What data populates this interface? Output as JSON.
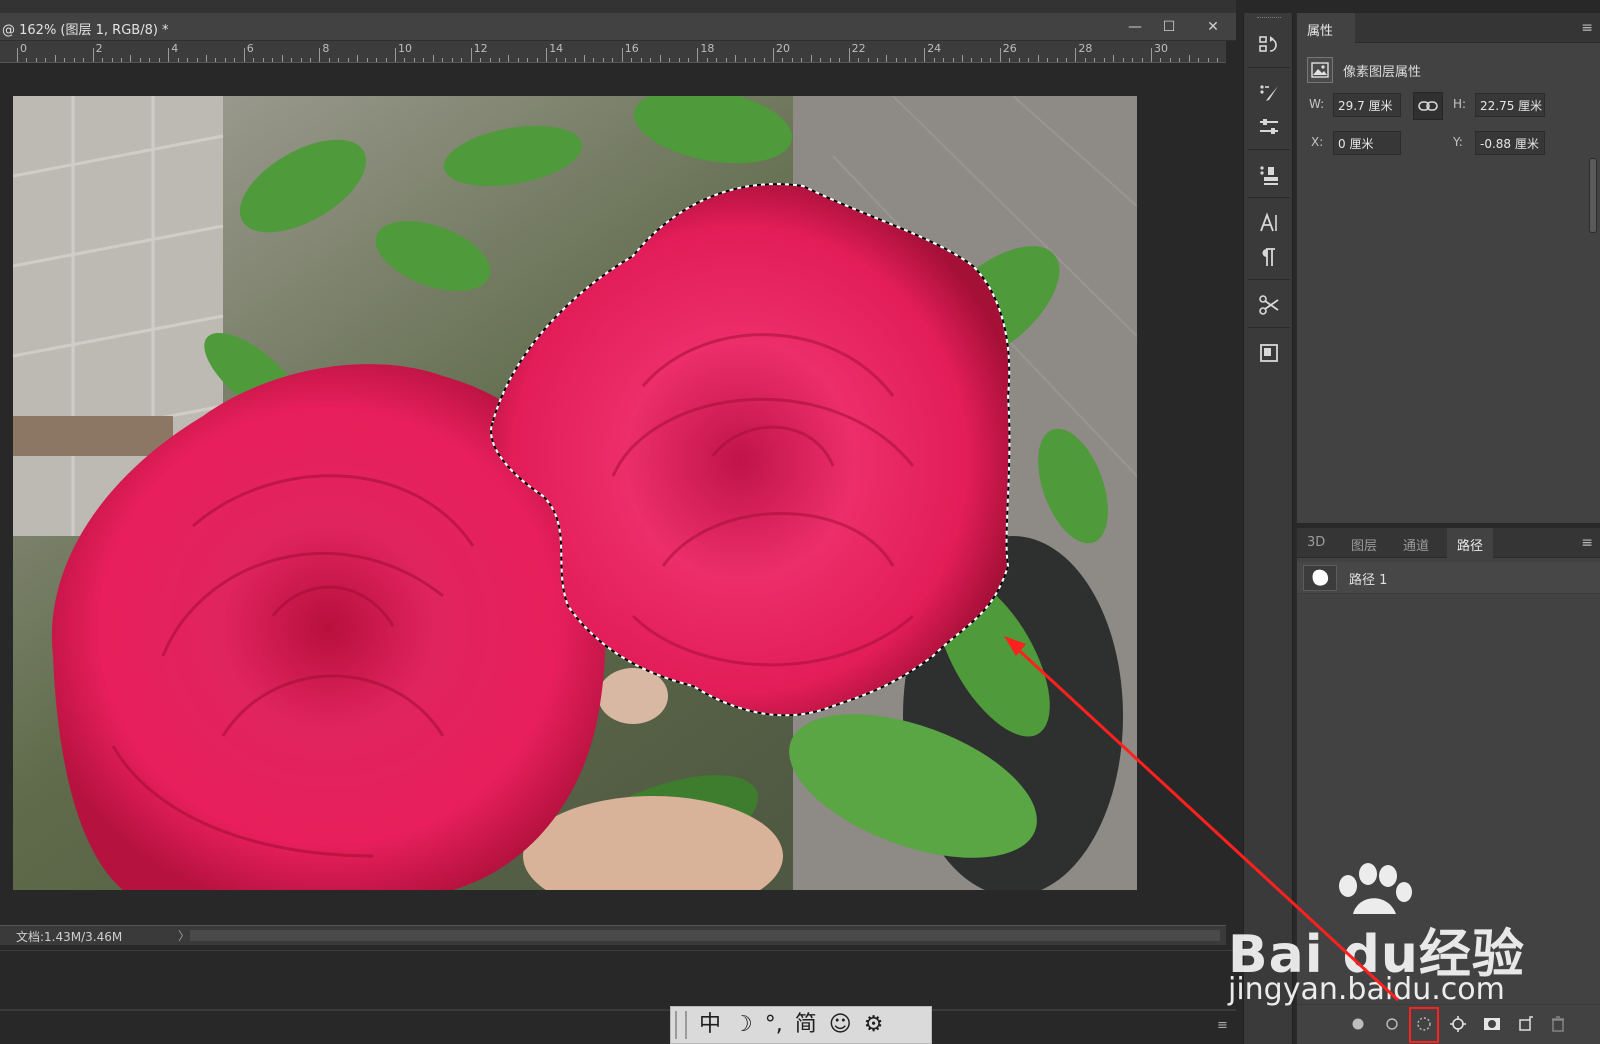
{
  "document": {
    "title": "@ 162% (图层 1, RGB/8) *",
    "window_buttons": {
      "minimize": "—",
      "restore": "☐",
      "close": "✕"
    },
    "ruler_labels": [
      "0",
      "2",
      "4",
      "6",
      "8",
      "10",
      "12",
      "14",
      "16",
      "18",
      "20",
      "22",
      "24",
      "26",
      "28",
      "30"
    ],
    "status_text": "文档:1.43M/3.46M",
    "status_arrow": "〉"
  },
  "tools": [
    "history-icon",
    "brush-preset-icon",
    "adjustments-icon",
    "clone-source-icon",
    "character-icon",
    "paragraph-icon",
    "tool-presets-icon",
    "info-icon"
  ],
  "properties_panel": {
    "tab": "属性",
    "title": "像素图层属性",
    "w_label": "W:",
    "w_value": "29.7 厘米",
    "h_label": "H:",
    "h_value": "22.75 厘米",
    "x_label": "X:",
    "x_value": "0 厘米",
    "y_label": "Y:",
    "y_value": "-0.88 厘米"
  },
  "paths_panel": {
    "tabs": [
      "3D",
      "图层",
      "通道",
      "路径"
    ],
    "active_tab": "路径",
    "items": [
      {
        "name": "路径 1"
      }
    ],
    "footer_buttons": [
      "fill-path-icon",
      "stroke-path-icon",
      "load-selection-icon",
      "make-work-path-icon",
      "add-mask-icon",
      "new-path-icon",
      "delete-path-icon"
    ]
  },
  "ime_bar": {
    "items": [
      "中",
      "☽",
      "°,",
      "简",
      "☺",
      "⚙"
    ]
  },
  "watermark": {
    "brand": "Bai du经验",
    "url": "jingyan.baidu.com"
  },
  "colors": {
    "annotation": "#ff2020",
    "panel_bg": "#424242",
    "canvas_bg": "#282828"
  }
}
